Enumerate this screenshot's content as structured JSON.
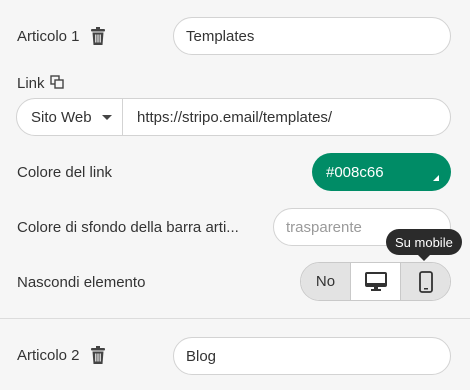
{
  "item1": {
    "label": "Articolo 1",
    "value": "Templates"
  },
  "link": {
    "label": "Link",
    "type": "Sito Web",
    "url": "https://stripo.email/templates/"
  },
  "link_color": {
    "label": "Colore del link",
    "value": "#008c66"
  },
  "bg_color": {
    "label": "Colore di sfondo della barra arti...",
    "placeholder": "trasparente"
  },
  "hide": {
    "label": "Nascondi elemento",
    "no_label": "No",
    "tooltip": "Su mobile"
  },
  "item2": {
    "label": "Articolo 2",
    "value": "Blog"
  },
  "colors": {
    "accent": "#008c66"
  }
}
